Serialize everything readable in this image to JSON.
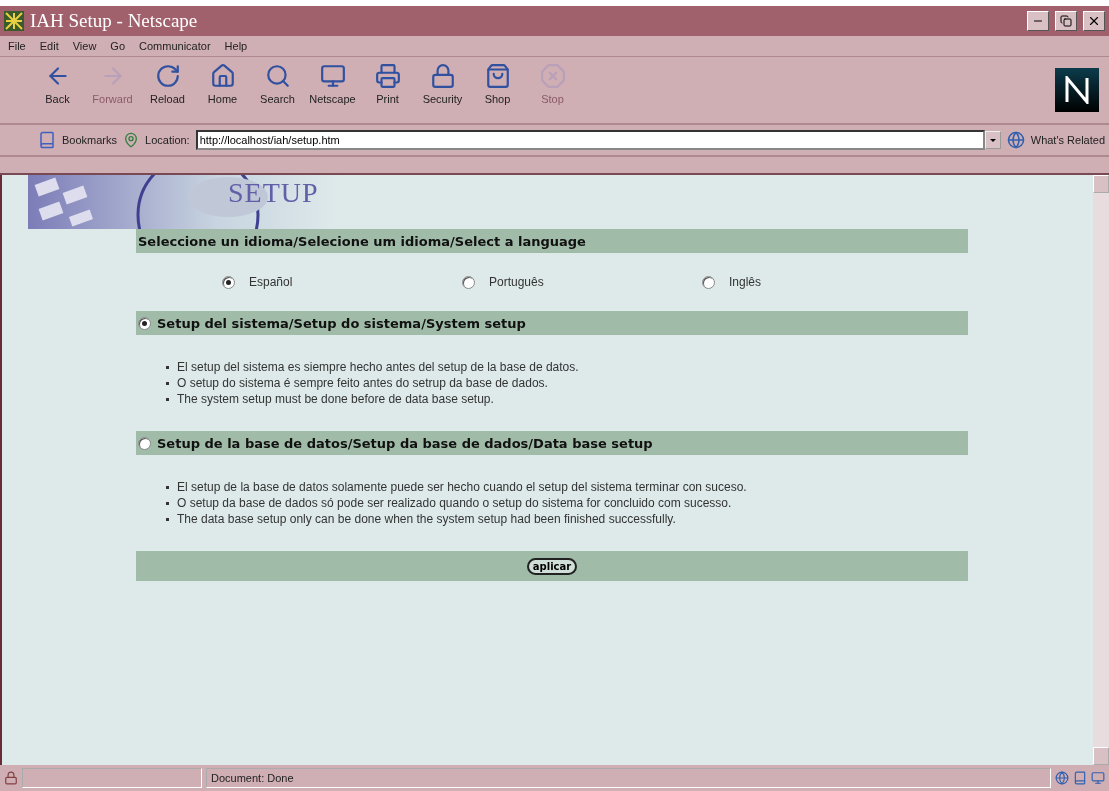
{
  "window": {
    "title": "IAH Setup - Netscape"
  },
  "menu": [
    "File",
    "Edit",
    "View",
    "Go",
    "Communicator",
    "Help"
  ],
  "toolbar": [
    {
      "kind": "back",
      "label": "Back",
      "disabled": false
    },
    {
      "kind": "forward",
      "label": "Forward",
      "disabled": true
    },
    {
      "kind": "reload",
      "label": "Reload",
      "disabled": false
    },
    {
      "kind": "home",
      "label": "Home",
      "disabled": false
    },
    {
      "kind": "search",
      "label": "Search",
      "disabled": false
    },
    {
      "kind": "netscape",
      "label": "Netscape",
      "disabled": false
    },
    {
      "kind": "print",
      "label": "Print",
      "disabled": false
    },
    {
      "kind": "security",
      "label": "Security",
      "disabled": false
    },
    {
      "kind": "shop",
      "label": "Shop",
      "disabled": false
    },
    {
      "kind": "stop",
      "label": "Stop",
      "disabled": true
    }
  ],
  "location_bar": {
    "bookmarks": "Bookmarks",
    "location_label": "Location:",
    "url": "http://localhost/iah/setup.htm",
    "related": "What's Related"
  },
  "page": {
    "banner": "SETUP",
    "language_heading": "Seleccione un idioma/Selecione um idioma/Select a language",
    "languages": [
      {
        "label": "Español",
        "selected": true
      },
      {
        "label": "Português",
        "selected": false
      },
      {
        "label": "Inglês",
        "selected": false
      }
    ],
    "sections": [
      {
        "title": "Setup del sistema/Setup do sistema/System setup",
        "selected": true,
        "notes": [
          "El setup del sistema es siempre hecho antes del setup de la base de datos.",
          "O setup do sistema é sempre feito antes do setrup da base de dados.",
          "The system setup must be done before de data base setup."
        ]
      },
      {
        "title": "Setup de la base de datos/Setup da base de dados/Data base setup",
        "selected": false,
        "notes": [
          "El setup de la base de datos solamente puede ser hecho cuando el setup del sistema terminar con suceso.",
          "O setup da base de dados só pode ser realizado quando o setup do sistema for concluido com sucesso.",
          "The data base setup only can be done when the system setup had been finished successfully."
        ]
      }
    ],
    "apply_button": "aplicar"
  },
  "status_bar": {
    "text": "Document: Done"
  }
}
